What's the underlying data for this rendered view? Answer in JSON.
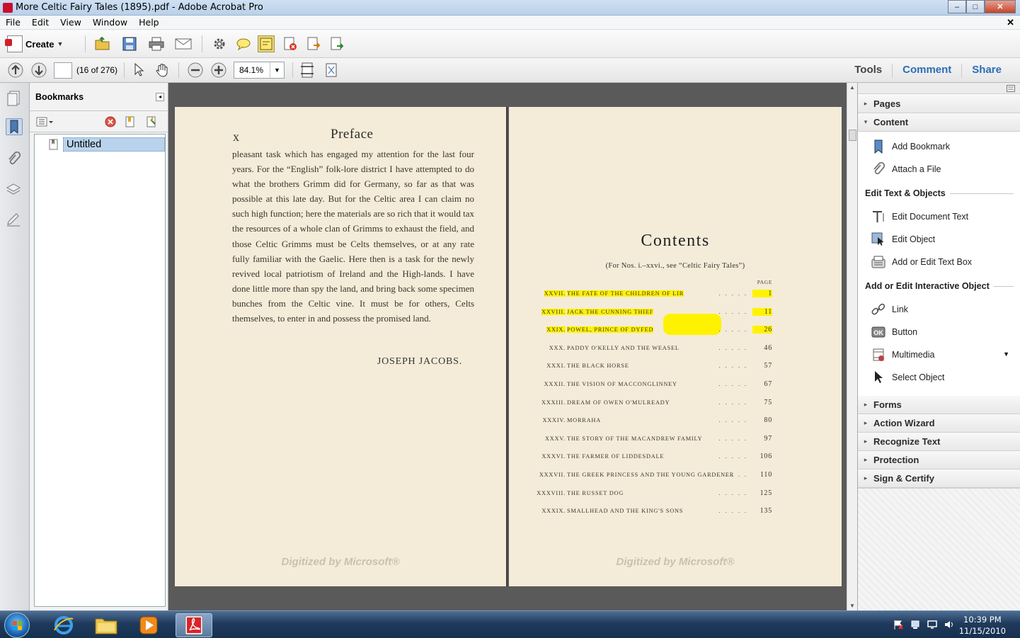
{
  "window": {
    "title": "More Celtic Fairy Tales (1895).pdf - Adobe Acrobat Pro",
    "controls": {
      "minimize": "–",
      "maximize": "□",
      "close": "✕"
    }
  },
  "menu": [
    "File",
    "Edit",
    "View",
    "Window",
    "Help"
  ],
  "doc_close": "✕",
  "toolbar": {
    "create_label": "Create",
    "page_number": "",
    "page_count": "(16 of 276)",
    "zoom": "84.1%",
    "tools_link": "Tools",
    "comment_link": "Comment",
    "share_link": "Share"
  },
  "bookmarks": {
    "title": "Bookmarks",
    "items": [
      {
        "label": "Untitled"
      }
    ]
  },
  "left_page": {
    "folio": "x",
    "title": "Preface",
    "body": "pleasant task which has engaged my attention for the last four years. For the “English” folk-lore district I have attempted to do what the brothers Grimm did for Germany, so far as that was possible at this late day. But for the Celtic area I can claim no such high function; here the materials are so rich that it would tax the resources of a whole clan of Grimms to exhaust the field, and those Celtic Grimms must be Celts themselves, or at any rate fully familiar with the Gaelic. Here then is a task for the newly revived local patriotism of Ireland and the High-lands. I have done little more than spy the land, and bring back some specimen bunches from the Celtic vine. It must be for others, Celts themselves, to enter in and possess the promised land.",
    "signature": "JOSEPH JACOBS.",
    "watermark": "Digitized by Microsoft®"
  },
  "right_page": {
    "title": "Contents",
    "subtitle": "(For Nos. i.–xxvi., see “Celtic Fairy Tales”)",
    "page_header": "PAGE",
    "entries": [
      {
        "num": "XXVII.",
        "name": "THE FATE OF THE CHILDREN OF LIR",
        "page": "1",
        "highlighted": true
      },
      {
        "num": "XXVIII.",
        "name": "JACK THE CUNNING THIEF",
        "page": "11",
        "highlighted": true
      },
      {
        "num": "XXIX.",
        "name": "POWEL, PRINCE OF DYFED",
        "page": "26",
        "highlighted": true
      },
      {
        "num": "XXX.",
        "name": "PADDY O'KELLY AND THE WEASEL",
        "page": "46",
        "highlighted": false
      },
      {
        "num": "XXXI.",
        "name": "THE BLACK HORSE",
        "page": "57",
        "highlighted": false
      },
      {
        "num": "XXXII.",
        "name": "THE VISION OF MACCONGLINNEY",
        "page": "67",
        "highlighted": false
      },
      {
        "num": "XXXIII.",
        "name": "DREAM OF OWEN O'MULREADY",
        "page": "75",
        "highlighted": false
      },
      {
        "num": "XXXIV.",
        "name": "MORRAHA",
        "page": "80",
        "highlighted": false
      },
      {
        "num": "XXXV.",
        "name": "THE STORY OF THE MACANDREW FAMILY",
        "page": "97",
        "highlighted": false
      },
      {
        "num": "XXXVI.",
        "name": "THE FARMER OF LIDDESDALE",
        "page": "106",
        "highlighted": false
      },
      {
        "num": "XXXVII.",
        "name": "THE GREEK PRINCESS AND THE YOUNG GARDENER",
        "page": "110",
        "highlighted": false
      },
      {
        "num": "XXXVIII.",
        "name": "THE RUSSET DOG",
        "page": "125",
        "highlighted": false
      },
      {
        "num": "XXXIX.",
        "name": "SMALLHEAD AND THE KING'S SONS",
        "page": "135",
        "highlighted": false
      }
    ],
    "watermark": "Digitized by Microsoft®"
  },
  "tools_pane": {
    "sections_top": [
      {
        "label": "Pages",
        "expanded": false
      },
      {
        "label": "Content",
        "expanded": true
      }
    ],
    "content_tools": [
      "Add Bookmark",
      "Attach a File"
    ],
    "edit_group": "Edit Text & Objects",
    "edit_tools": [
      "Edit Document Text",
      "Edit Object",
      "Add or Edit Text Box"
    ],
    "interactive_group": "Add or Edit Interactive Object",
    "interactive_tools": [
      "Link",
      "Button",
      "Multimedia",
      "Select Object"
    ],
    "sections_bottom": [
      "Forms",
      "Action Wizard",
      "Recognize Text",
      "Protection",
      "Sign & Certify"
    ]
  },
  "taskbar": {
    "time": "10:39 PM",
    "date": "11/15/2010"
  },
  "colors": {
    "highlight": "#fff200",
    "page_paper": "#f4ecd8",
    "link_blue": "#2a6eb5"
  }
}
